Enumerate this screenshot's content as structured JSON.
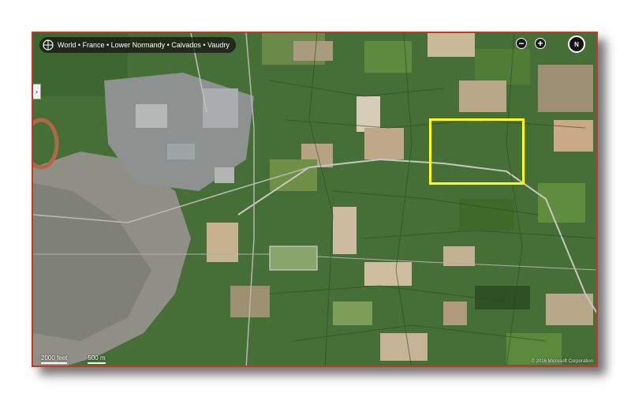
{
  "breadcrumb": {
    "text": "World • France • Lower Normandy • Calvados • Vaudry",
    "icon": "globe-icon"
  },
  "controls": {
    "zoom_out_label": "−",
    "zoom_in_label": "+",
    "compass_label": "N",
    "sidebar_toggle_label": "›"
  },
  "scale": {
    "feet_label": "2000 feet",
    "meters_label": "500 m"
  },
  "copyright": "© 2016 Microsoft Corporation",
  "colors": {
    "frame_border": "#c0392b",
    "highlight": "#ffff1a"
  }
}
